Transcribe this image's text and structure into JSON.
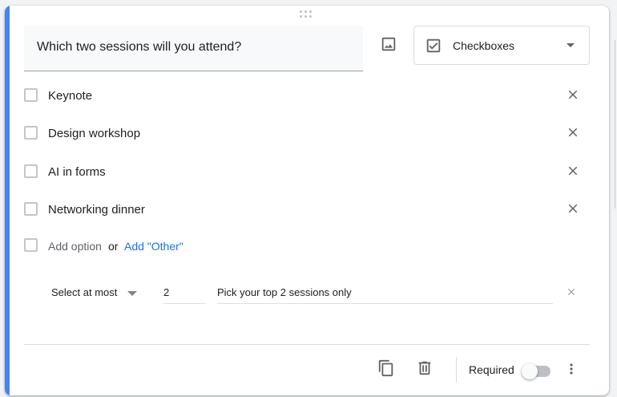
{
  "question": {
    "title": "Which two sessions will you attend?",
    "type_label": "Checkboxes",
    "type_icon": "checkbox-icon"
  },
  "options": [
    {
      "label": "Keynote"
    },
    {
      "label": "Design workshop"
    },
    {
      "label": "AI in forms"
    },
    {
      "label": "Networking dinner"
    }
  ],
  "add_row": {
    "add_option": "Add option",
    "or": "or",
    "add_other": "Add \"Other\""
  },
  "validation": {
    "rule": "Select at most",
    "number": "2",
    "error_text": "Pick your top 2 sessions only"
  },
  "footer": {
    "required_label": "Required",
    "required_on": false
  },
  "colors": {
    "accent": "#4285f4",
    "link": "#1a73e8"
  }
}
